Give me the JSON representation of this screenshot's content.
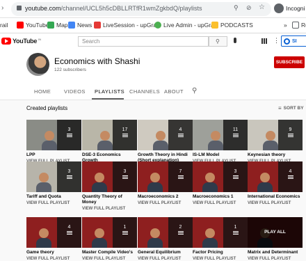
{
  "browser": {
    "url_domain": "youtube.com",
    "url_path": "/channel/UCL5h5cDBLLRTfR1wmZgkbdQ/playlists",
    "profile_label": "Incogni"
  },
  "bookmarks": [
    {
      "label": "rail",
      "color": "transparent"
    },
    {
      "label": "YouTube",
      "color": "#ff0000"
    },
    {
      "label": "Maps",
      "color": "#34a853"
    },
    {
      "label": "News",
      "color": "#4285f4"
    },
    {
      "label": "LiveSession - upGrad",
      "color": "#e53935"
    },
    {
      "label": "Live Admin - upGrad",
      "color": "#4caf50"
    },
    {
      "label": "PODCASTS",
      "color": "#fbc02d"
    }
  ],
  "bookmarks_more": "»",
  "bookmarks_tail": "Re",
  "youtube": {
    "logo_text": "YouTube",
    "logo_region": "IN",
    "search_placeholder": "Search",
    "signin_label": "SI"
  },
  "channel": {
    "name": "Economics with Shashi",
    "subscribers": "122 subscribers",
    "subscribe_label": "SUBSCRIBE"
  },
  "tabs": [
    "HOME",
    "VIDEOS",
    "PLAYLISTS",
    "CHANNELS",
    "ABOUT"
  ],
  "section": {
    "title": "Created playlists",
    "sort_label": "SORT BY"
  },
  "playlists": [
    {
      "title": "LPP",
      "count": "3",
      "link": "VIEW FULL PLAYLIST",
      "bg": "#8a8c86"
    },
    {
      "title": "DSE-3 Economics Growth",
      "count": "17",
      "link": "VIEW FULL PLAYLIST",
      "bg": "#b9b6a8"
    },
    {
      "title": "Growth Theory in Hindi (Short explanation)",
      "count": "4",
      "link": "VIEW FULL PLAYLIST",
      "bg": "#cfcac0"
    },
    {
      "title": "IS-LM Model",
      "count": "11",
      "link": "VIEW FULL PLAYLIST",
      "bg": "#9ea09a"
    },
    {
      "title": "Keynesian theory",
      "count": "9",
      "link": "VIEW FULL PLAYLIST",
      "bg": "#c9c6bd"
    },
    {
      "title": "Tariff and Quota",
      "count": "3",
      "link": "VIEW FULL PLAYLIST",
      "bg": "#b7b4aa"
    },
    {
      "title": "Quantity Theory of Money",
      "count": "3",
      "link": "VIEW FULL PLAYLIST",
      "bg": "#8e1f1f"
    },
    {
      "title": "Macroeconomics 2",
      "count": "7",
      "link": "VIEW FULL PLAYLIST",
      "bg": "#8e1f1f"
    },
    {
      "title": "Macroeconomics 1",
      "count": "3",
      "link": "VIEW FULL PLAYLIST",
      "bg": "#8e1f1f"
    },
    {
      "title": "International Economics",
      "count": "4",
      "link": "VIEW FULL PLAYLIST",
      "bg": "#8e1f1f"
    },
    {
      "title": "Game theory",
      "count": "4",
      "link": "VIEW FULL PLAYLIST",
      "bg": "#8e1f1f"
    },
    {
      "title": "Master Compile Video's",
      "count": "1",
      "link": "VIEW FULL PLAYLIST",
      "bg": "#8e1f1f"
    },
    {
      "title": "General Equilibrium",
      "count": "2",
      "link": "VIEW FULL PLAYLIST",
      "bg": "#8e1f1f"
    },
    {
      "title": "Factor Pricing",
      "count": "1",
      "link": "VIEW FULL PLAYLIST",
      "bg": "#8e1f1f"
    },
    {
      "title": "Matrix and Determinant",
      "count": "",
      "hover_label": "PLAY ALL",
      "link": "VIEW FULL PLAYLIST",
      "bg": "#8e1f1f"
    }
  ],
  "colors": {
    "brand_red": "#ff0000",
    "subscribe_red": "#cc0000",
    "signin_blue": "#065fd4",
    "page_bg": "#f9f9f9"
  }
}
